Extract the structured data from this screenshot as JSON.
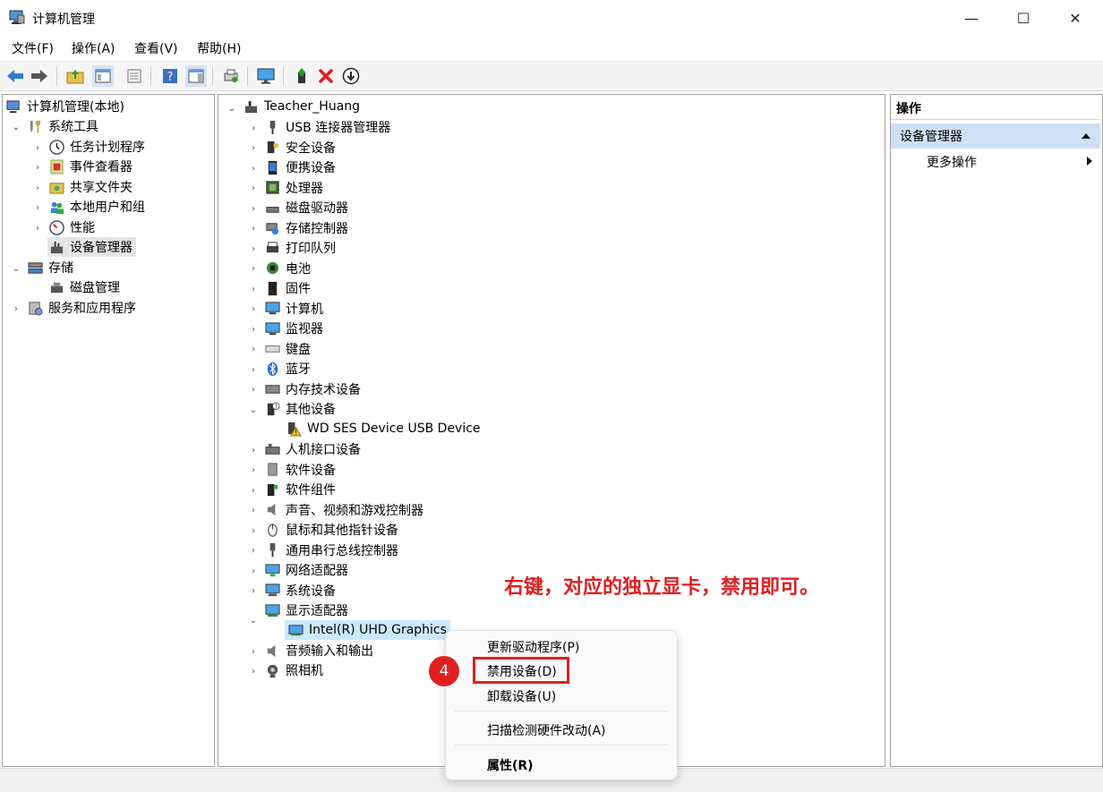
{
  "window": {
    "title": "计算机管理",
    "minimize": "—",
    "maximize": "☐",
    "close": "✕"
  },
  "menubar": [
    "文件(F)",
    "操作(A)",
    "查看(V)",
    "帮助(H)"
  ],
  "left_tree": {
    "root": "计算机管理(本地)",
    "system_tools": "系统工具",
    "task_scheduler": "任务计划程序",
    "event_viewer": "事件查看器",
    "shared_folders": "共享文件夹",
    "local_users": "本地用户和组",
    "performance": "性能",
    "device_manager": "设备管理器",
    "storage": "存储",
    "disk_management": "磁盘管理",
    "services_apps": "服务和应用程序"
  },
  "device_tree": {
    "root": "Teacher_Huang",
    "categories": [
      "USB 连接器管理器",
      "安全设备",
      "便携设备",
      "处理器",
      "磁盘驱动器",
      "存储控制器",
      "打印队列",
      "电池",
      "固件",
      "计算机",
      "监视器",
      "键盘",
      "蓝牙",
      "内存技术设备"
    ],
    "other_devices": "其他设备",
    "wd_device": "WD SES Device USB Device",
    "categories_2": [
      "人机接口设备",
      "软件设备",
      "软件组件",
      "声音、视频和游戏控制器",
      "鼠标和其他指针设备",
      "通用串行总线控制器",
      "网络适配器",
      "系统设备"
    ],
    "display_adapters": "显示适配器",
    "intel_gpu": "Intel(R) UHD Graphics",
    "audio_io": "音频输入和输出",
    "camera": "照相机"
  },
  "actions": {
    "header": "操作",
    "section": "设备管理器",
    "more": "更多操作"
  },
  "context_menu": {
    "update_driver": "更新驱动程序(P)",
    "disable": "禁用设备(D)",
    "uninstall": "卸载设备(U)",
    "scan": "扫描检测硬件改动(A)",
    "properties": "属性(R)"
  },
  "annotation": {
    "text": "右键，对应的独立显卡，禁用即可。",
    "step": "4",
    "color": "#e02020"
  }
}
